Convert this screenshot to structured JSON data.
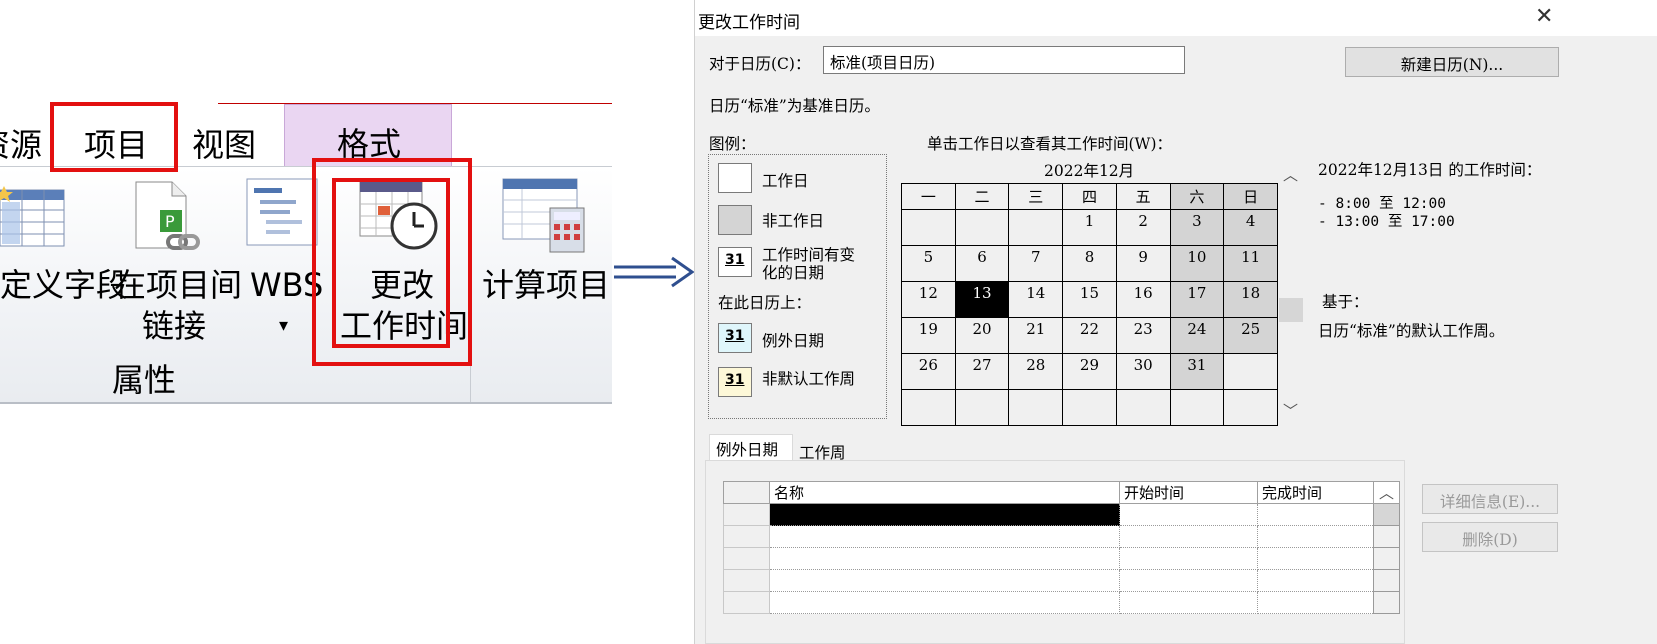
{
  "ribbon": {
    "tabs": [
      "资源",
      "项目",
      "视图",
      "格式"
    ],
    "buttons": {
      "custom_fields": "定义字段",
      "links_between": [
        "在项目间",
        "链接"
      ],
      "wbs": "WBS",
      "wbs_arrow": "▾",
      "change_working_time": [
        "更改",
        "工作时间"
      ],
      "calculate_project": "计算项目"
    },
    "group_label": "属性"
  },
  "dialog": {
    "title": "更改工作时间",
    "close": "✕",
    "for_calendar_label": "对于日历(C)：",
    "for_calendar_value": "标准(项目日历)",
    "new_calendar_button": "新建日历(N)...",
    "base_info": "日历“标准”为基准日历。",
    "legend_title": "图例：",
    "legend": {
      "working": "工作日",
      "nonworking": "非工作日",
      "edited": [
        "工作时间有变",
        "化的日期"
      ],
      "on_this_calendar": "在此日历上：",
      "exception": "例外日期",
      "nondefault_week": "非默认工作周",
      "swatch_number": "31"
    },
    "click_hint": "单击工作日以查看其工作时间(W)：",
    "month_title": "2022年12月",
    "weekdays": [
      "一",
      "二",
      "三",
      "四",
      "五",
      "六",
      "日"
    ],
    "weeks": [
      [
        "",
        "",
        "",
        "1",
        "2",
        "3",
        "4"
      ],
      [
        "5",
        "6",
        "7",
        "8",
        "9",
        "10",
        "11"
      ],
      [
        "12",
        "13",
        "14",
        "15",
        "16",
        "17",
        "18"
      ],
      [
        "19",
        "20",
        "21",
        "22",
        "23",
        "24",
        "25"
      ],
      [
        "26",
        "27",
        "28",
        "29",
        "30",
        "31",
        ""
      ],
      [
        "",
        "",
        "",
        "",
        "",
        "",
        ""
      ]
    ],
    "working_time_title": "2022年12月13日 的工作时间：",
    "working_times": [
      "- 8:00 至 12:00",
      "- 13:00 至 17:00"
    ],
    "based_on_label": "基于：",
    "based_on_value": "日历“标准”的默认工作周。",
    "tabs": [
      "例外日期",
      "工作周"
    ],
    "grid_headers": [
      "名称",
      "开始时间",
      "完成时间"
    ],
    "details_button": "详细信息(E)...",
    "delete_button": "删除(D)",
    "scroll_up": "^",
    "scroll_down": "v"
  },
  "colors": {
    "highlight_red": "#e31010",
    "format_tab": "#ead6f2",
    "nonworking_gray": "#d4d4d4",
    "arrow_blue": "#2f4f8f"
  }
}
